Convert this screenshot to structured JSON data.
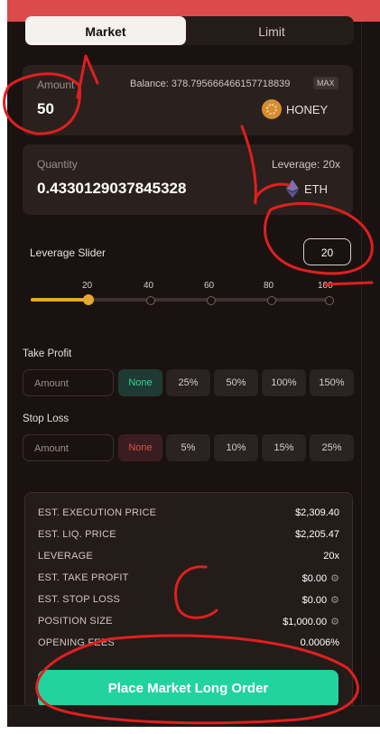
{
  "order_type": {
    "market_label": "Market",
    "limit_label": "Limit"
  },
  "amount_card": {
    "label": "Amount",
    "value": "50",
    "balance_text": "Balance: 378.795666466157718839",
    "max_label": "MAX",
    "token": "HONEY"
  },
  "quantity_card": {
    "label": "Quantity",
    "value": "0.4330129037845328",
    "leverage_text": "Leverage: 20x",
    "token": "ETH"
  },
  "leverage_slider": {
    "label": "Leverage Slider",
    "input_value": "20",
    "tick_labels": [
      "20",
      "40",
      "60",
      "80",
      "100"
    ],
    "current_level": 20
  },
  "take_profit": {
    "label": "Take Profit",
    "input_placeholder": "Amount",
    "options": [
      "None",
      "25%",
      "50%",
      "100%",
      "150%"
    ]
  },
  "stop_loss": {
    "label": "Stop Loss",
    "input_placeholder": "Amount",
    "options": [
      "None",
      "5%",
      "10%",
      "15%",
      "25%"
    ]
  },
  "summary": {
    "rows": [
      {
        "label": "EST. EXECUTION PRICE",
        "value": "$2,309.40"
      },
      {
        "label": "EST. LIQ. PRICE",
        "value": "$2,205.47"
      },
      {
        "label": "LEVERAGE",
        "value": "20x"
      },
      {
        "label": "EST. TAKE PROFIT",
        "value": "$0.00"
      },
      {
        "label": "EST. STOP LOSS",
        "value": "$0.00"
      },
      {
        "label": "POSITION SIZE",
        "value": "$1,000.00"
      },
      {
        "label": "OPENING FEES",
        "value": "0.0006%"
      }
    ]
  },
  "place_order_label": "Place Market Long Order",
  "colors": {
    "background": "#1a1210",
    "accent_green": "#22d3a0",
    "slider_gold": "#e6a82e",
    "annotation_red": "#e01f1f"
  }
}
